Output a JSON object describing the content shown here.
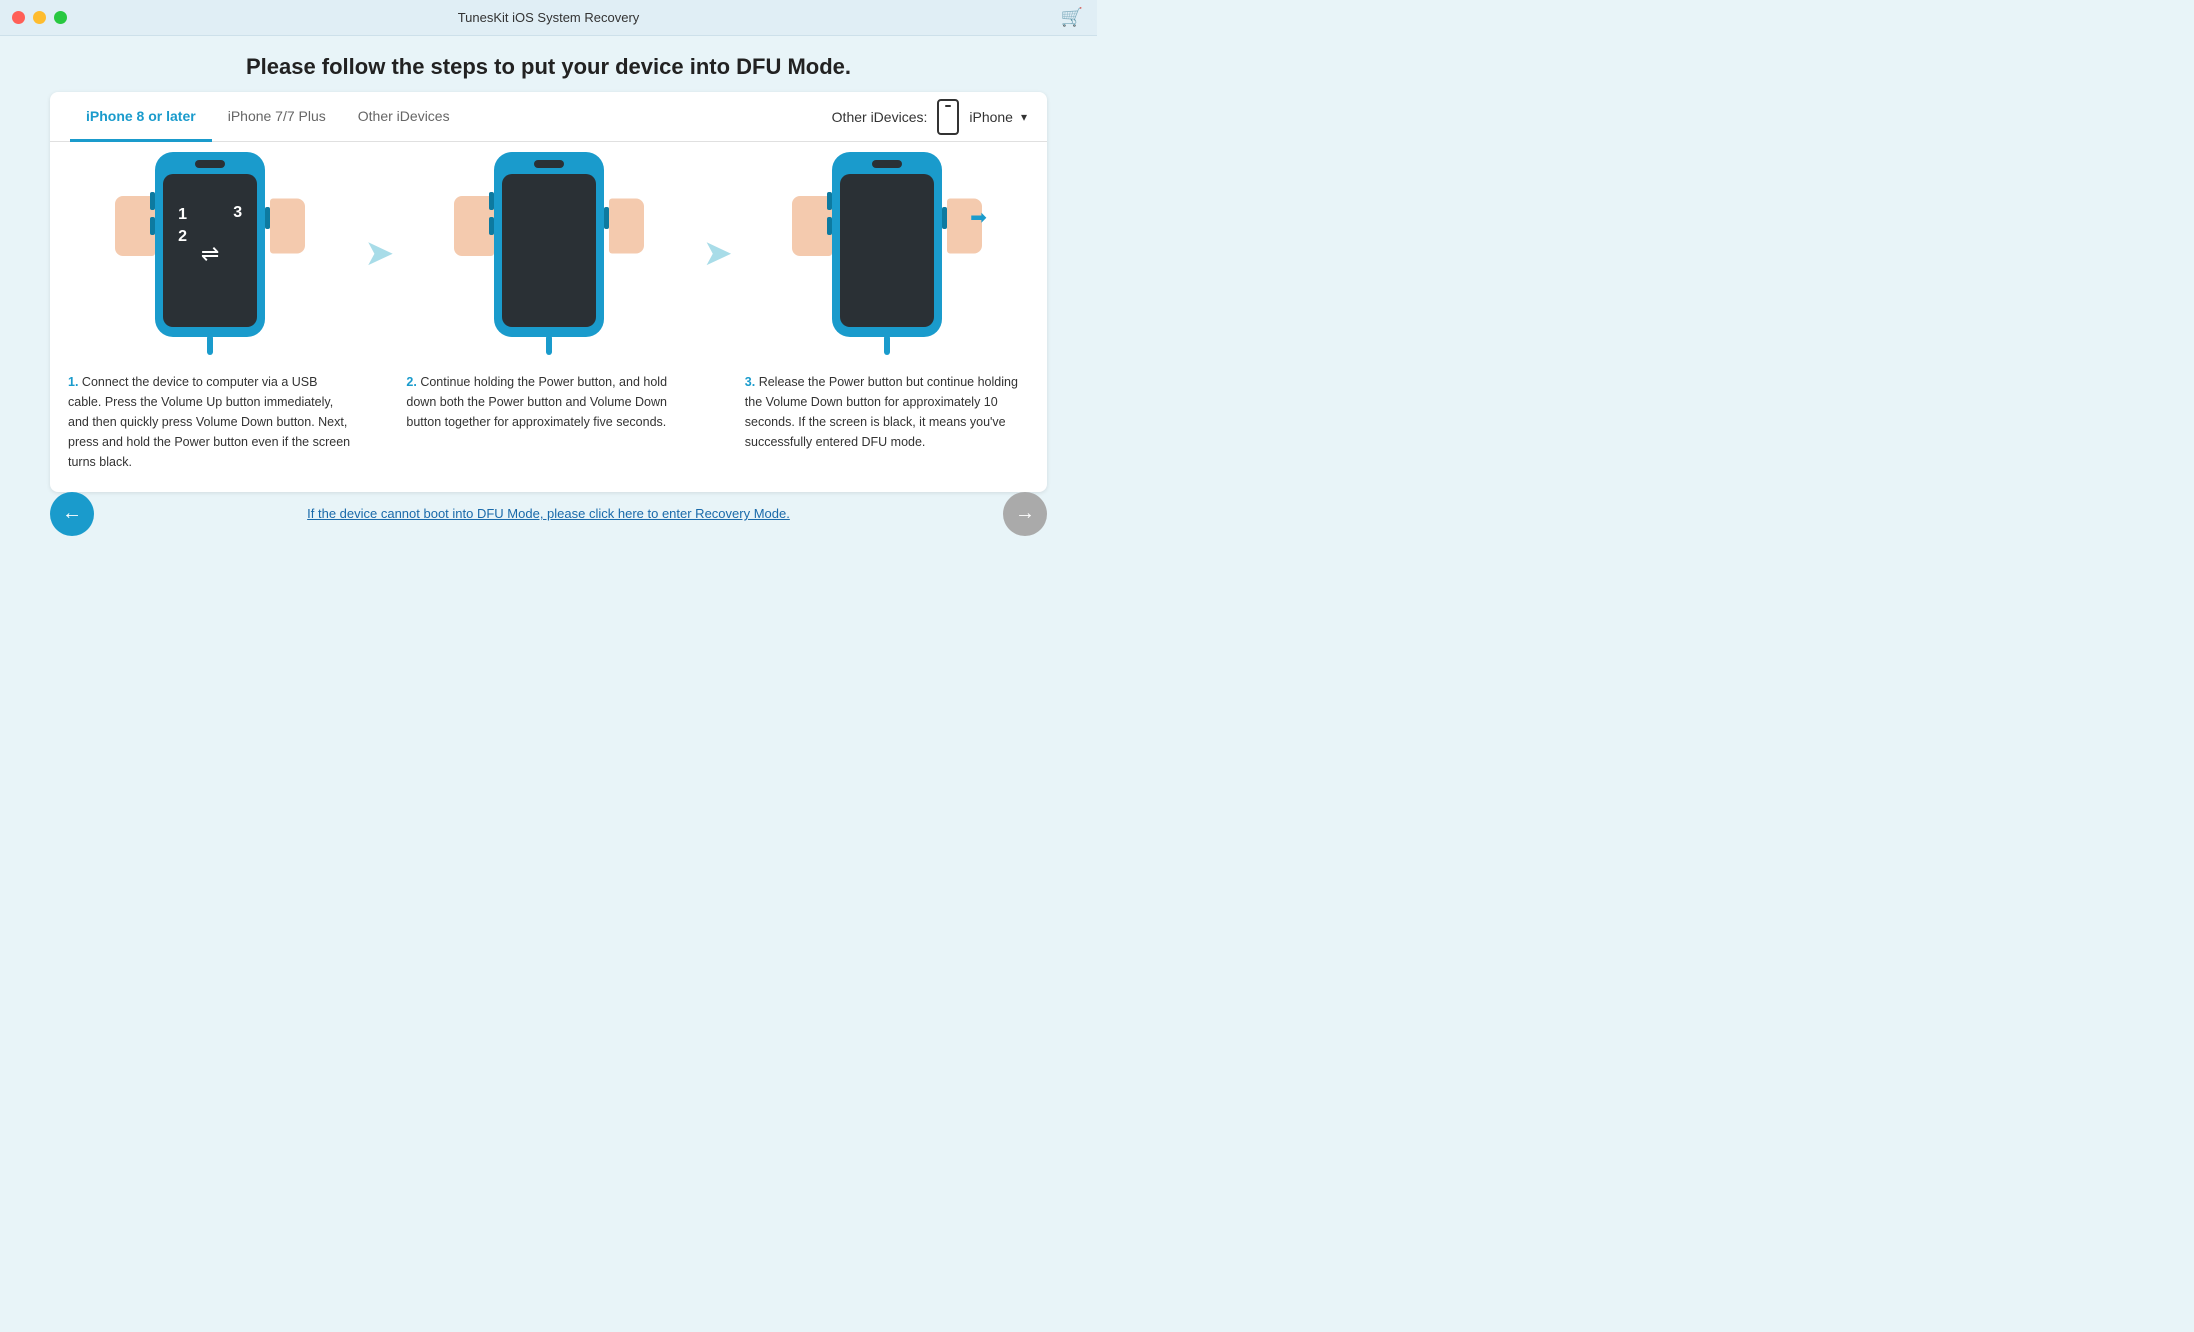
{
  "titleBar": {
    "title": "TunesKit iOS System Recovery",
    "cartIcon": "🛒"
  },
  "mainHeading": "Please follow the steps to put your device into DFU Mode.",
  "tabs": [
    {
      "id": "iphone8",
      "label": "iPhone 8 or later",
      "active": true
    },
    {
      "id": "iphone7",
      "label": "iPhone 7/7 Plus",
      "active": false
    },
    {
      "id": "other",
      "label": "Other iDevices",
      "active": false
    }
  ],
  "otherDevicesLabel": "Other iDevices:",
  "deviceName": "iPhone",
  "steps": [
    {
      "number": "1",
      "screenLabels": {
        "top": "1\n2",
        "right": "3"
      },
      "hasUSB": true,
      "description": "Connect the device to computer via a USB cable. Press the Volume Up button immediately, and then quickly press Volume Down button. Next, press and hold the Power button even if the screen turns black."
    },
    {
      "number": "2",
      "screenLabels": {},
      "hasUSB": false,
      "description": "Continue holding the Power button, and hold down both the Power button and Volume Down button together for approximately five seconds."
    },
    {
      "number": "3",
      "screenLabels": {},
      "hasUSB": false,
      "hasReleaseArrow": true,
      "description": "Release the Power button but continue holding the Volume Down button for approximately 10 seconds. If the screen is black, it means you've successfully entered DFU mode."
    }
  ],
  "recoveryLink": "If the device cannot boot into DFU Mode, please click here to enter Recovery Mode.",
  "navigation": {
    "backLabel": "←",
    "nextLabel": "→"
  }
}
